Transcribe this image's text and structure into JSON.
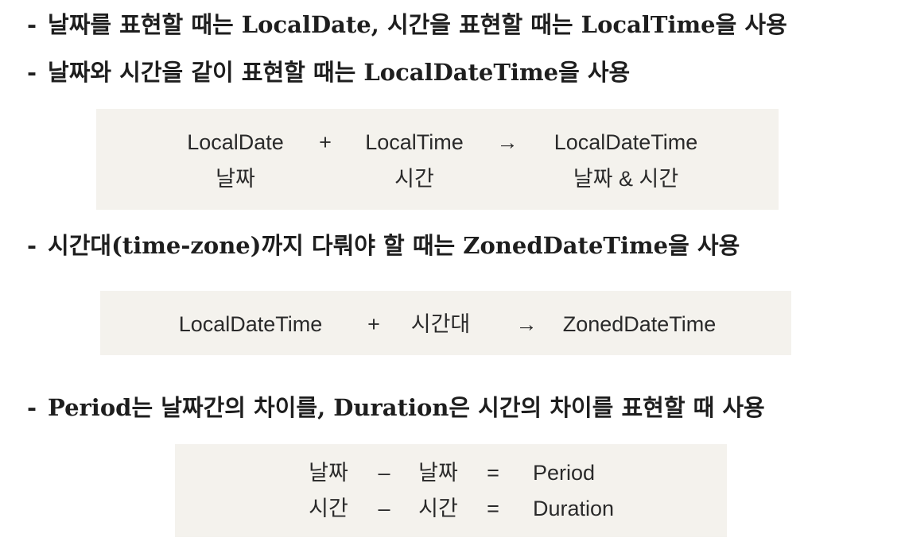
{
  "lines": {
    "line1": "날짜를 표현할 때는 LocalDate, 시간을 표현할 때는 LocalTime을 사용",
    "line2": "날짜와 시간을 같이 표현할 때는 LocalDateTime을 사용",
    "line3": "시간대(time-zone)까지 다뤄야 할 때는 ZonedDateTime을 사용",
    "line4": "Period는 날짜간의 차이를, Duration은 시간의 차이를 표현할 때 사용"
  },
  "dash": "-",
  "box1": {
    "row1": [
      "LocalDate",
      "+",
      "LocalTime",
      "→",
      "LocalDateTime"
    ],
    "row2": [
      "날짜",
      "시간",
      "날짜 & 시간"
    ]
  },
  "box2": {
    "row1": [
      "LocalDateTime",
      "+",
      "시간대",
      "→",
      "ZonedDateTime"
    ]
  },
  "box3": {
    "row1": [
      "날짜",
      "–",
      "날짜",
      "=",
      "Period"
    ],
    "row2": [
      "시간",
      "–",
      "시간",
      "=",
      "Duration"
    ]
  }
}
